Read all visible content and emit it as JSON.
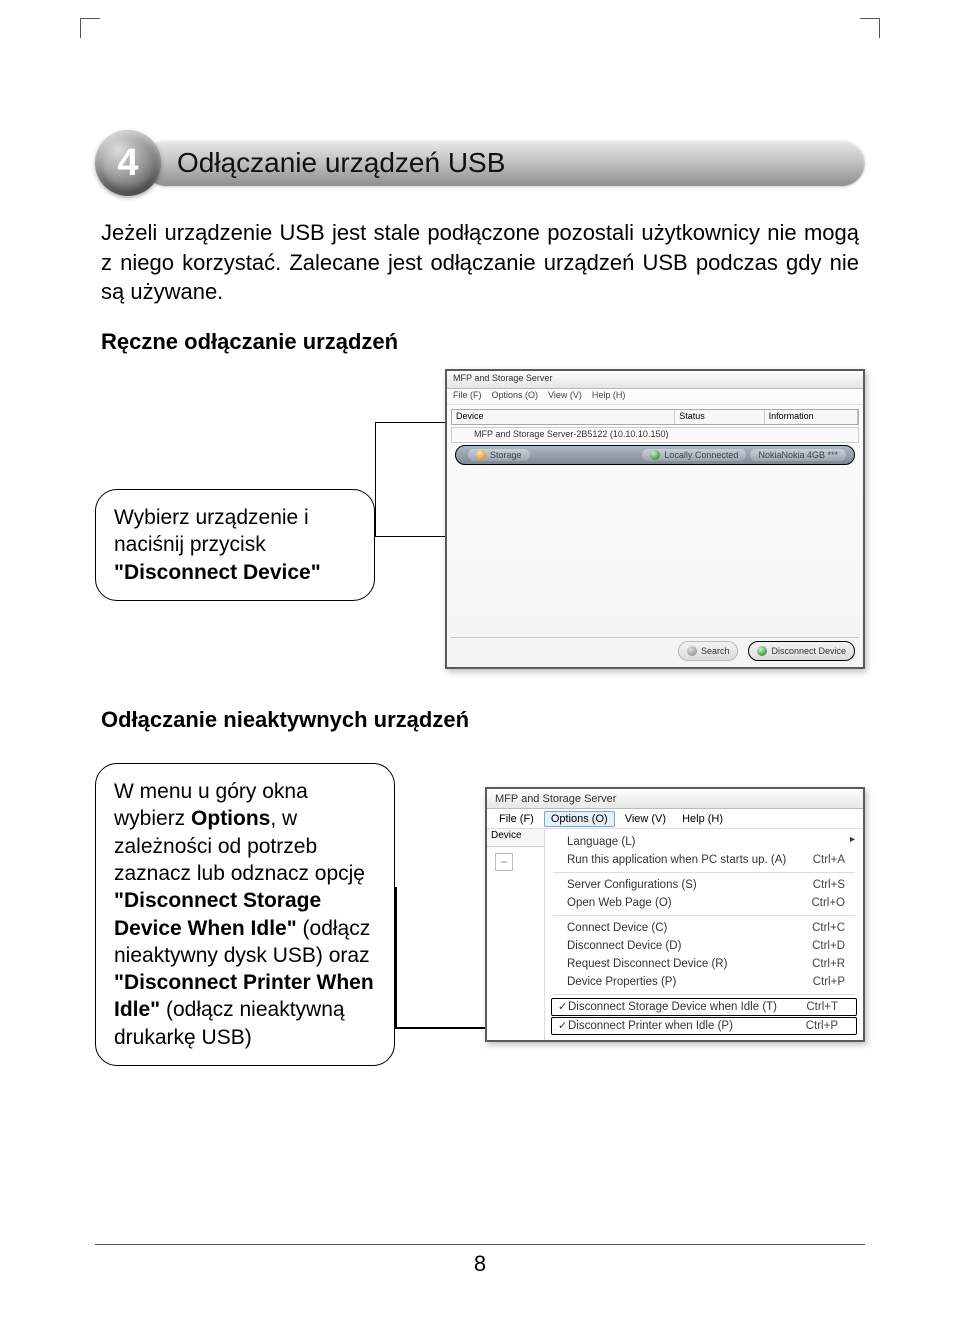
{
  "badge_number": "4",
  "title": "Odłączanie urządzeń USB",
  "intro": "Jeżeli urządzenie USB jest stale podłączone pozostali użytkownicy nie mogą z niego korzystać. Zalecane jest odłączanie urządzeń USB podczas gdy nie są używane.",
  "subhead1": "Ręczne odłączanie urządzeń",
  "callout1_pre": "Wybierz urządzenie i naciśnij przycisk ",
  "callout1_bold": "\"Disconnect Device\"",
  "subhead2": "Odłączanie nieaktywnych urządzeń",
  "callout2_l1": "W menu u góry okna wybierz ",
  "callout2_b1": "Options",
  "callout2_l2": ", w zależności od potrzeb zaznacz lub odznacz opcję ",
  "callout2_b2": "\"Disconnect Storage Device When Idle\"",
  "callout2_l3": " (odłącz nieaktywny dysk USB) oraz ",
  "callout2_b3": "\"Disconnect Printer When Idle\"",
  "callout2_l4": " (odłącz nieaktywną drukarkę USB)",
  "page_number": "8",
  "win1": {
    "title": "MFP and Storage Server",
    "menu": [
      "File (F)",
      "Options (O)",
      "View (V)",
      "Help (H)"
    ],
    "cols": [
      "Device",
      "Status",
      "Information"
    ],
    "row_server": "MFP and Storage Server-2B5122  (10.10.10.150)",
    "row_hi_left": "Storage",
    "row_hi_mid": "Locally Connected",
    "row_hi_right": "NokiaNokia 4GB ***",
    "btn_search": "Search",
    "btn_disconnect": "Disconnect Device"
  },
  "win2": {
    "title": "MFP and Storage Server",
    "menu": [
      "File (F)",
      "Options (O)",
      "View (V)",
      "Help (H)"
    ],
    "left_header": "Device",
    "items": [
      {
        "label": "Language (L)",
        "sc": "",
        "arrow": true
      },
      {
        "label": "Run this application when PC starts up. (A)",
        "sc": "Ctrl+A"
      },
      {
        "sep": true
      },
      {
        "label": "Server Configurations (S)",
        "sc": "Ctrl+S"
      },
      {
        "label": "Open Web Page (O)",
        "sc": "Ctrl+O"
      },
      {
        "sep": true
      },
      {
        "label": "Connect Device (C)",
        "sc": "Ctrl+C"
      },
      {
        "label": "Disconnect Device  (D)",
        "sc": "Ctrl+D"
      },
      {
        "label": "Request Disconnect Device  (R)",
        "sc": "Ctrl+R"
      },
      {
        "label": "Device Properties  (P)",
        "sc": "Ctrl+P"
      },
      {
        "sep": true
      },
      {
        "label": "Disconnect Storage Device when Idle  (T)",
        "sc": "Ctrl+T",
        "check": true,
        "hi": true
      },
      {
        "label": "Disconnect Printer when Idle  (P)",
        "sc": "Ctrl+P",
        "check": true,
        "hi": true
      }
    ]
  }
}
